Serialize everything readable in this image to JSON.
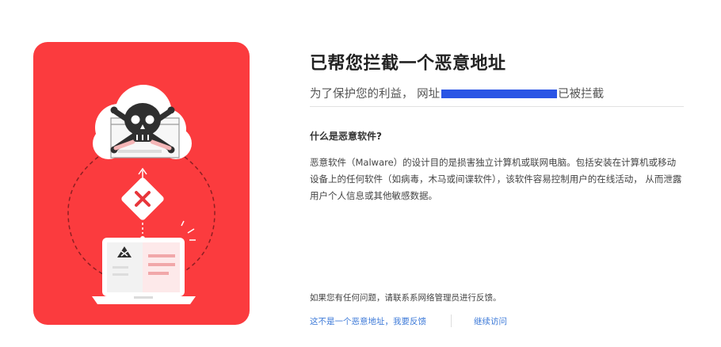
{
  "page": {
    "title": "已帮您拦截一个恶意地址",
    "subtitle_prefix": "为了保护您的利益， 网址",
    "subtitle_suffix": "已被拦截",
    "section_heading": "什么是恶意软件?",
    "description": "恶意软件（Malware）的设计目的是损害独立计算机或联网电脑。包括安装在计算机或移动设备上的任何软件（如病毒，木马或间谍软件），该软件容易控制用户的在线活动， 从而泄露用户个人信息或其他敏感数据。",
    "contact_text": "如果您有任何问题，请联系系网络管理员进行反馈。",
    "report_link": "这不是一个恶意地址，我要反馈",
    "continue_link": "继续访问"
  },
  "colors": {
    "danger_red": "#fb3b3e",
    "link_blue": "#3d7ad8",
    "redaction_blue": "#2a55e5"
  },
  "icons": {
    "illustration": "malware-warning-illustration",
    "skull": "skull-crossbones-icon",
    "blocked": "x-mark-icon",
    "laptop": "laptop-icon"
  }
}
